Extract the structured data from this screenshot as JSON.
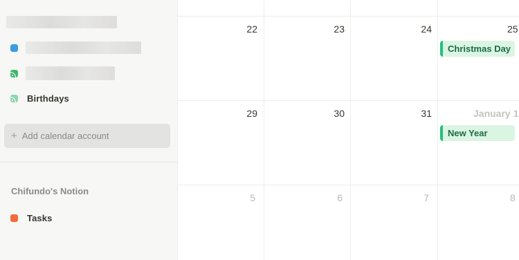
{
  "sidebar": {
    "calendars": [
      {
        "label": "",
        "color": "#3b9de0",
        "icon": "calendar-color-dot"
      },
      {
        "label": "",
        "color": "#40b86b",
        "icon": "feed-icon"
      },
      {
        "label": "Birthdays",
        "color": "#8fd6ad",
        "icon": "feed-icon"
      }
    ],
    "add_account_label": "Add calendar account",
    "notion_section_title": "Chifundo's Notion",
    "notion_items": [
      {
        "label": "Tasks",
        "color": "#f26b3a",
        "icon": "calendar-color-dot"
      }
    ]
  },
  "calendar": {
    "weeks": [
      {
        "days": [
          "22",
          "23",
          "24",
          "25"
        ]
      },
      {
        "days": [
          "29",
          "30",
          "31",
          "January 1"
        ]
      },
      {
        "days": [
          "5",
          "6",
          "7",
          "8"
        ]
      }
    ],
    "events": [
      {
        "title": "Christmas Day",
        "day": "25",
        "color": "#22c07a"
      },
      {
        "title": "New Year",
        "day": "January 1",
        "color": "#22c07a"
      }
    ]
  }
}
